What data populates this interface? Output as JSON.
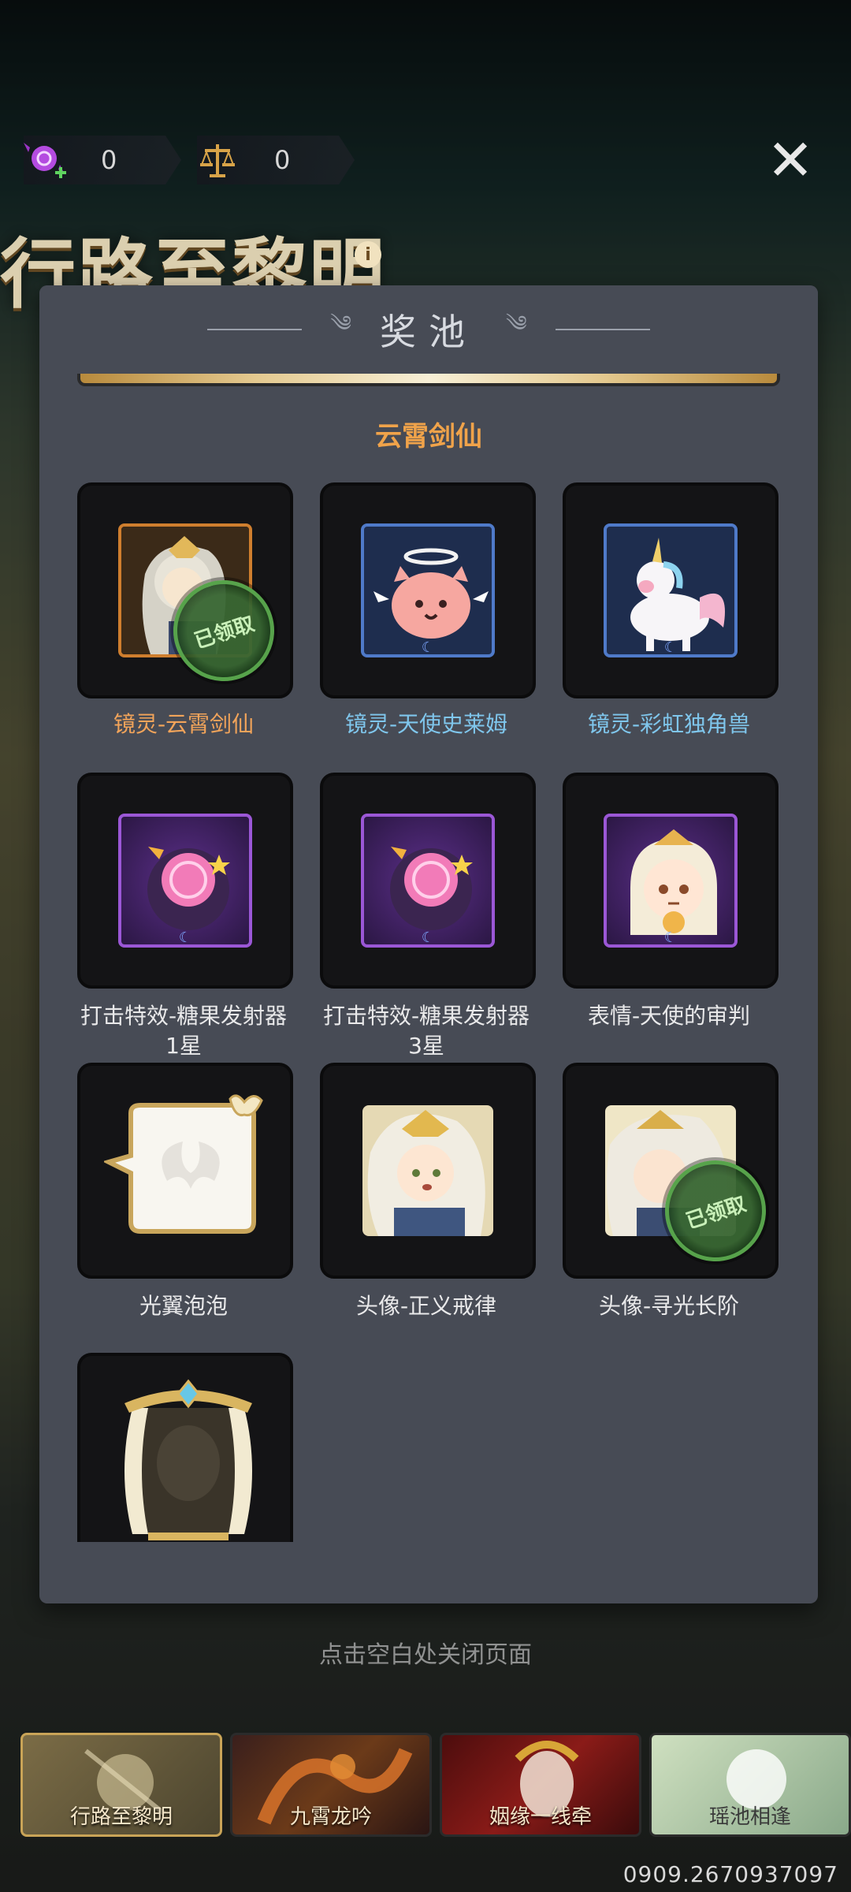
{
  "currencies": [
    {
      "icon": "candy-plus-icon",
      "value": "0"
    },
    {
      "icon": "scales-icon",
      "value": "0"
    }
  ],
  "background_title": "行路至黎明",
  "modal": {
    "title": "奖池",
    "section_title": "云霄剑仙",
    "claimed_label": "已领取",
    "items": [
      {
        "label": "镜灵-云霄剑仙",
        "claimed": true
      },
      {
        "label": "镜灵-天使史莱姆",
        "claimed": false
      },
      {
        "label": "镜灵-彩虹独角兽",
        "claimed": false
      },
      {
        "label": "打击特效-糖果发射器\n1星",
        "claimed": false
      },
      {
        "label": "打击特效-糖果发射器\n3星",
        "claimed": false
      },
      {
        "label": "表情-天使的审判",
        "claimed": false
      },
      {
        "label": "光翼泡泡",
        "claimed": false
      },
      {
        "label": "头像-正义戒律",
        "claimed": false
      },
      {
        "label": "头像-寻光长阶",
        "claimed": true
      },
      {
        "label": "",
        "claimed": false
      }
    ]
  },
  "close_hint": "点击空白处关闭页面",
  "tabs": [
    {
      "label": "行路至黎明",
      "active": true
    },
    {
      "label": "九霄龙吟",
      "active": false
    },
    {
      "label": "姻缘一线牵",
      "active": false
    },
    {
      "label": "瑶池相逢",
      "active": false
    }
  ],
  "uid": "0909.2670937097"
}
